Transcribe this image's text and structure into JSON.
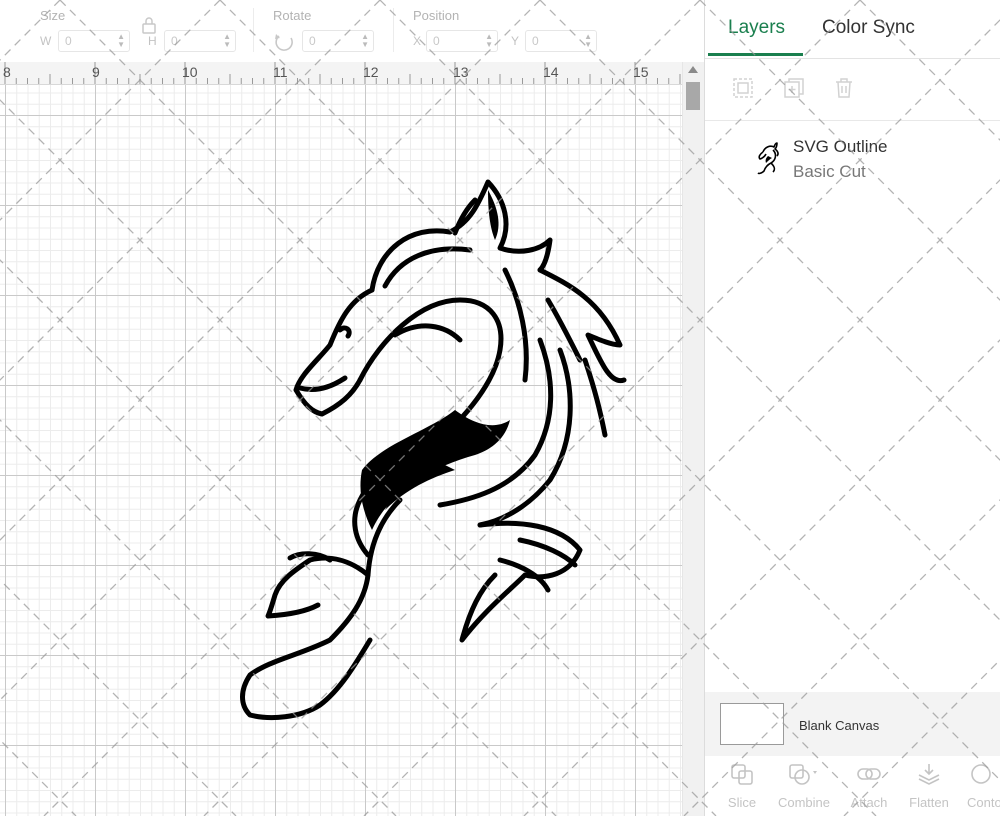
{
  "toolbar": {
    "size": {
      "label": "Size",
      "w_axis": "W",
      "w_value": "0",
      "h_axis": "H",
      "h_value": "0"
    },
    "rotate": {
      "label": "Rotate",
      "value": "0"
    },
    "position": {
      "label": "Position",
      "x_axis": "X",
      "x_value": "0",
      "y_axis": "Y",
      "y_value": "0"
    }
  },
  "ruler": {
    "ticks": [
      "8",
      "9",
      "10",
      "11",
      "12",
      "13",
      "14",
      "15"
    ]
  },
  "panel": {
    "tabs": [
      {
        "label": "Layers",
        "active": true
      },
      {
        "label": "Color Sync",
        "active": false
      }
    ],
    "layer": {
      "name": "SVG Outline",
      "operation": "Basic Cut",
      "icon": "horse-icon"
    },
    "blank_canvas": {
      "label": "Blank Canvas"
    },
    "bottom_tools": [
      {
        "label": "Slice",
        "icon": "slice-icon"
      },
      {
        "label": "Combine",
        "icon": "combine-icon"
      },
      {
        "label": "Attach",
        "icon": "attach-icon"
      },
      {
        "label": "Flatten",
        "icon": "flatten-icon"
      },
      {
        "label": "Conto",
        "icon": "contour-icon"
      }
    ]
  },
  "colors": {
    "accent": "#1a7f4e",
    "artwork": "#000000"
  }
}
